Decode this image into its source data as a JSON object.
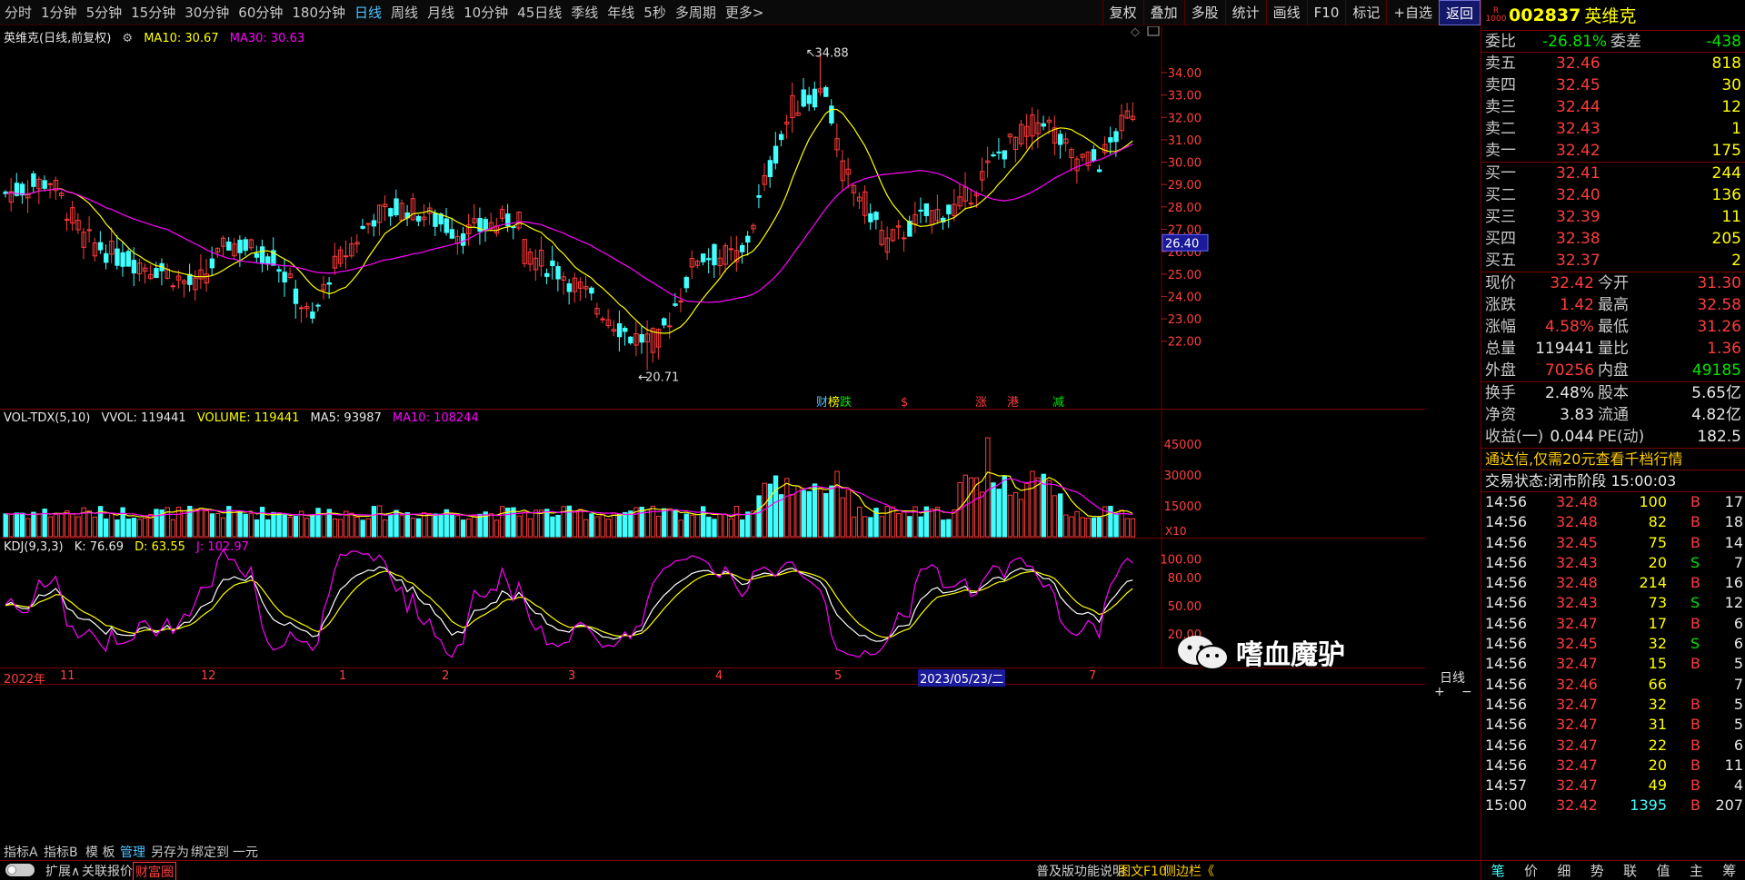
{
  "toolbar": {
    "periods": [
      "分时",
      "1分钟",
      "5分钟",
      "15分钟",
      "30分钟",
      "60分钟",
      "180分钟",
      "日线",
      "周线",
      "月线",
      "10分钟",
      "45日线",
      "季线",
      "年线",
      "5秒",
      "多周期",
      "更多>"
    ],
    "active_period": "日线",
    "tools": [
      "复权",
      "叠加",
      "多股",
      "统计",
      "画线",
      "F10",
      "标记",
      "+自选",
      "返回"
    ]
  },
  "kline": {
    "title": "英维克(日线,前复权)",
    "ma10_label": "MA10: 30.67",
    "ma30_label": "MA30: 30.63",
    "high_note": "34.88",
    "low_note": "20.71",
    "current_price_tag": "26.40",
    "event_markers": [
      "财",
      "榜",
      "跌",
      "$",
      "涨",
      "港",
      "减"
    ],
    "y_ticks": [
      "34.00",
      "33.00",
      "32.00",
      "31.00",
      "30.00",
      "29.00",
      "28.00",
      "27.00",
      "26.00",
      "25.00",
      "24.00",
      "23.00",
      "22.00"
    ]
  },
  "volume": {
    "label": "VOL-TDX(5,10)",
    "vvol": "VVOL: 119441",
    "volume": "VOLUME: 119441",
    "ma5": "MA5: 93987",
    "ma10": "MA10: 108244",
    "y_ticks": [
      "45000",
      "30000",
      "15000"
    ],
    "unit": "X10"
  },
  "kdj": {
    "label": "KDJ(9,3,3)",
    "k": "K: 76.69",
    "d": "D: 63.55",
    "j": "J: 102.97",
    "y_ticks": [
      "100.00",
      "80.00",
      "50.00",
      "20.00"
    ]
  },
  "date_axis": {
    "labels": [
      "2022年",
      "11",
      "12",
      "1",
      "2",
      "3",
      "4",
      "5",
      "2023/05/23/二",
      "7"
    ],
    "period_label": "日线"
  },
  "tabs": [
    "指标A",
    "指标B",
    "模 板",
    "管理",
    "另存为",
    "绑定到",
    "一元"
  ],
  "bottom": [
    "扩展∧",
    "关联报价",
    "财富圈",
    "普及版功能说明",
    "图文F10",
    "侧边栏《"
  ],
  "panel": {
    "mark": "R 1000",
    "code": "002837",
    "name": "英维克",
    "weibi_label": "委比",
    "weibi": "-26.81%",
    "weicha_label": "委差",
    "weicha": "-438",
    "asks": [
      {
        "label": "卖五",
        "price": "32.46",
        "vol": "818"
      },
      {
        "label": "卖四",
        "price": "32.45",
        "vol": "30"
      },
      {
        "label": "卖三",
        "price": "32.44",
        "vol": "12"
      },
      {
        "label": "卖二",
        "price": "32.43",
        "vol": "1"
      },
      {
        "label": "卖一",
        "price": "32.42",
        "vol": "175"
      }
    ],
    "bids": [
      {
        "label": "买一",
        "price": "32.41",
        "vol": "244"
      },
      {
        "label": "买二",
        "price": "32.40",
        "vol": "136"
      },
      {
        "label": "买三",
        "price": "32.39",
        "vol": "11"
      },
      {
        "label": "买四",
        "price": "32.38",
        "vol": "205"
      },
      {
        "label": "买五",
        "price": "32.37",
        "vol": "2"
      }
    ],
    "quote": [
      {
        "l1": "现价",
        "v1": "32.42",
        "l2": "今开",
        "v2": "31.30"
      },
      {
        "l1": "涨跌",
        "v1": "1.42",
        "l2": "最高",
        "v2": "32.58"
      },
      {
        "l1": "涨幅",
        "v1": "4.58%",
        "l2": "最低",
        "v2": "31.26"
      },
      {
        "l1": "总量",
        "v1": "119441",
        "l2": "量比",
        "v2": "1.36"
      },
      {
        "l1": "外盘",
        "v1": "70256",
        "l2": "内盘",
        "v2": "49185"
      }
    ],
    "fund": [
      {
        "l1": "换手",
        "v1": "2.48%",
        "l2": "股本",
        "v2": "5.65亿"
      },
      {
        "l1": "净资",
        "v1": "3.83",
        "l2": "流通",
        "v2": "4.82亿"
      },
      {
        "l1": "收益(一)",
        "v1": "0.044",
        "l2": "PE(动)",
        "v2": "182.5"
      }
    ],
    "ad": "通达信,仅需20元查看千档行情",
    "status": "交易状态:闭市阶段 15:00:03",
    "ticks": [
      {
        "t": "14:56",
        "p": "32.48",
        "v": "100",
        "bs": "B",
        "n": "17"
      },
      {
        "t": "14:56",
        "p": "32.48",
        "v": "82",
        "bs": "B",
        "n": "18"
      },
      {
        "t": "14:56",
        "p": "32.45",
        "v": "75",
        "bs": "B",
        "n": "14"
      },
      {
        "t": "14:56",
        "p": "32.43",
        "v": "20",
        "bs": "S",
        "n": "7"
      },
      {
        "t": "14:56",
        "p": "32.48",
        "v": "214",
        "bs": "B",
        "n": "16"
      },
      {
        "t": "14:56",
        "p": "32.43",
        "v": "73",
        "bs": "S",
        "n": "12"
      },
      {
        "t": "14:56",
        "p": "32.47",
        "v": "17",
        "bs": "B",
        "n": "6"
      },
      {
        "t": "14:56",
        "p": "32.45",
        "v": "32",
        "bs": "S",
        "n": "6"
      },
      {
        "t": "14:56",
        "p": "32.47",
        "v": "15",
        "bs": "B",
        "n": "5"
      },
      {
        "t": "14:56",
        "p": "32.46",
        "v": "66",
        "bs": "",
        "n": "7"
      },
      {
        "t": "14:56",
        "p": "32.47",
        "v": "32",
        "bs": "B",
        "n": "5"
      },
      {
        "t": "14:56",
        "p": "32.47",
        "v": "31",
        "bs": "B",
        "n": "5"
      },
      {
        "t": "14:56",
        "p": "32.47",
        "v": "22",
        "bs": "B",
        "n": "6"
      },
      {
        "t": "14:56",
        "p": "32.47",
        "v": "20",
        "bs": "B",
        "n": "11"
      },
      {
        "t": "14:57",
        "p": "32.47",
        "v": "49",
        "bs": "B",
        "n": "4"
      },
      {
        "t": "15:00",
        "p": "32.42",
        "v": "1395",
        "bs": "B",
        "n": "207"
      }
    ],
    "tabs": [
      "笔",
      "价",
      "细",
      "势",
      "联",
      "值",
      "主",
      "筹"
    ]
  },
  "watermark": "嗜血魔驴",
  "colors": {
    "up": "#ff3c3c",
    "down": "#40ffff",
    "ma10": "#ffff00",
    "ma30": "#ff00ff",
    "k": "#ffffff",
    "d": "#ffff00",
    "j": "#ff00ff",
    "grid": "#7a0000"
  }
}
